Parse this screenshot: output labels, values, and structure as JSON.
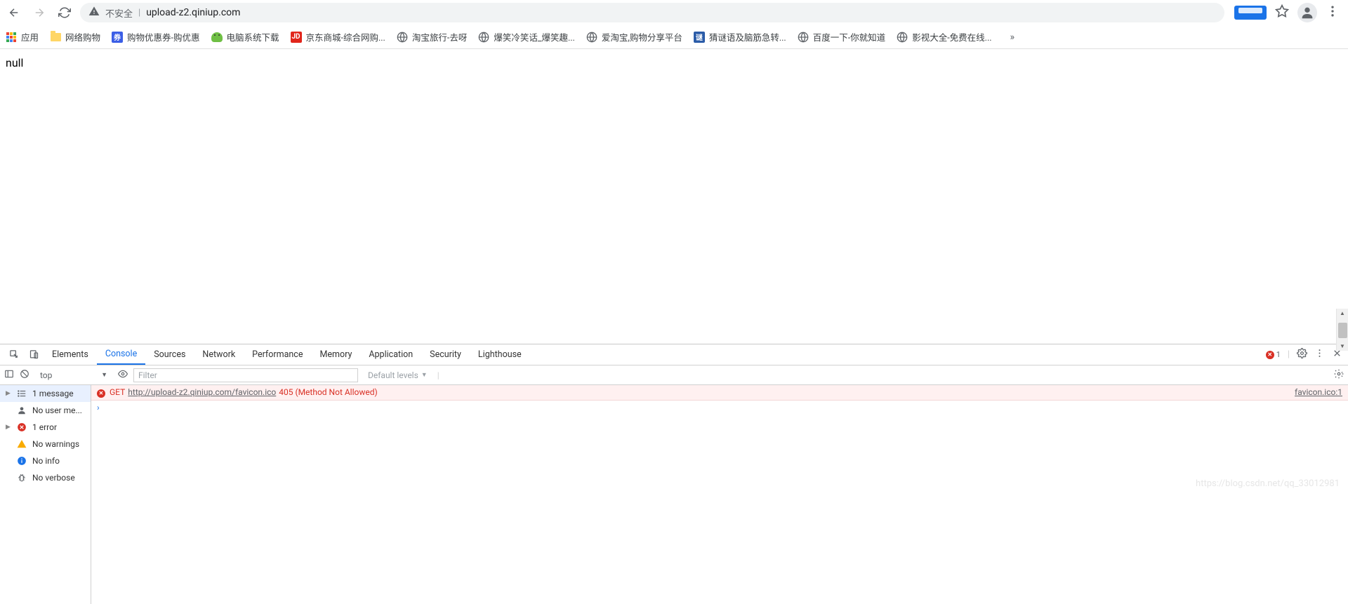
{
  "toolbar": {
    "insecure_label": "不安全",
    "url": "upload-z2.qiniup.com"
  },
  "bookmarks": {
    "apps": "应用",
    "items": [
      {
        "icon": "folder",
        "label": "网络购物"
      },
      {
        "icon": "blue-sq",
        "text": "券",
        "color": "#3b5ee6",
        "label": "购物优惠券-购优惠"
      },
      {
        "icon": "bug",
        "label": "电脑系统下载"
      },
      {
        "icon": "red-sq",
        "text": "JD",
        "color": "#e1251b",
        "label": "京东商城-综合网购..."
      },
      {
        "icon": "globe",
        "label": "淘宝旅行-去呀"
      },
      {
        "icon": "globe",
        "label": "爆笑冷笑话_爆笑趣..."
      },
      {
        "icon": "globe",
        "label": "爱淘宝,购物分享平台"
      },
      {
        "icon": "blue-sq",
        "text": "谜",
        "color": "#2b5ca8",
        "label": "猜谜语及脑筋急转..."
      },
      {
        "icon": "globe",
        "label": "百度一下-你就知道"
      },
      {
        "icon": "globe",
        "label": "影视大全-免费在线..."
      }
    ]
  },
  "page": {
    "body": "null"
  },
  "devtools": {
    "tabs": [
      "Elements",
      "Console",
      "Sources",
      "Network",
      "Performance",
      "Memory",
      "Application",
      "Security",
      "Lighthouse"
    ],
    "active_tab": "Console",
    "error_count": "1",
    "context": "top",
    "filter_placeholder": "Filter",
    "levels": "Default levels",
    "sidebar": {
      "messages": "1 message",
      "user": "No user me...",
      "errors": "1 error",
      "warnings": "No warnings",
      "info": "No info",
      "verbose": "No verbose"
    },
    "log": {
      "method": "GET",
      "url": "http://upload-z2.qiniup.com/favicon.ico",
      "status": "405 (Method Not Allowed)",
      "source": "favicon.ico:1"
    }
  },
  "watermark": "https://blog.csdn.net/qq_33012981"
}
